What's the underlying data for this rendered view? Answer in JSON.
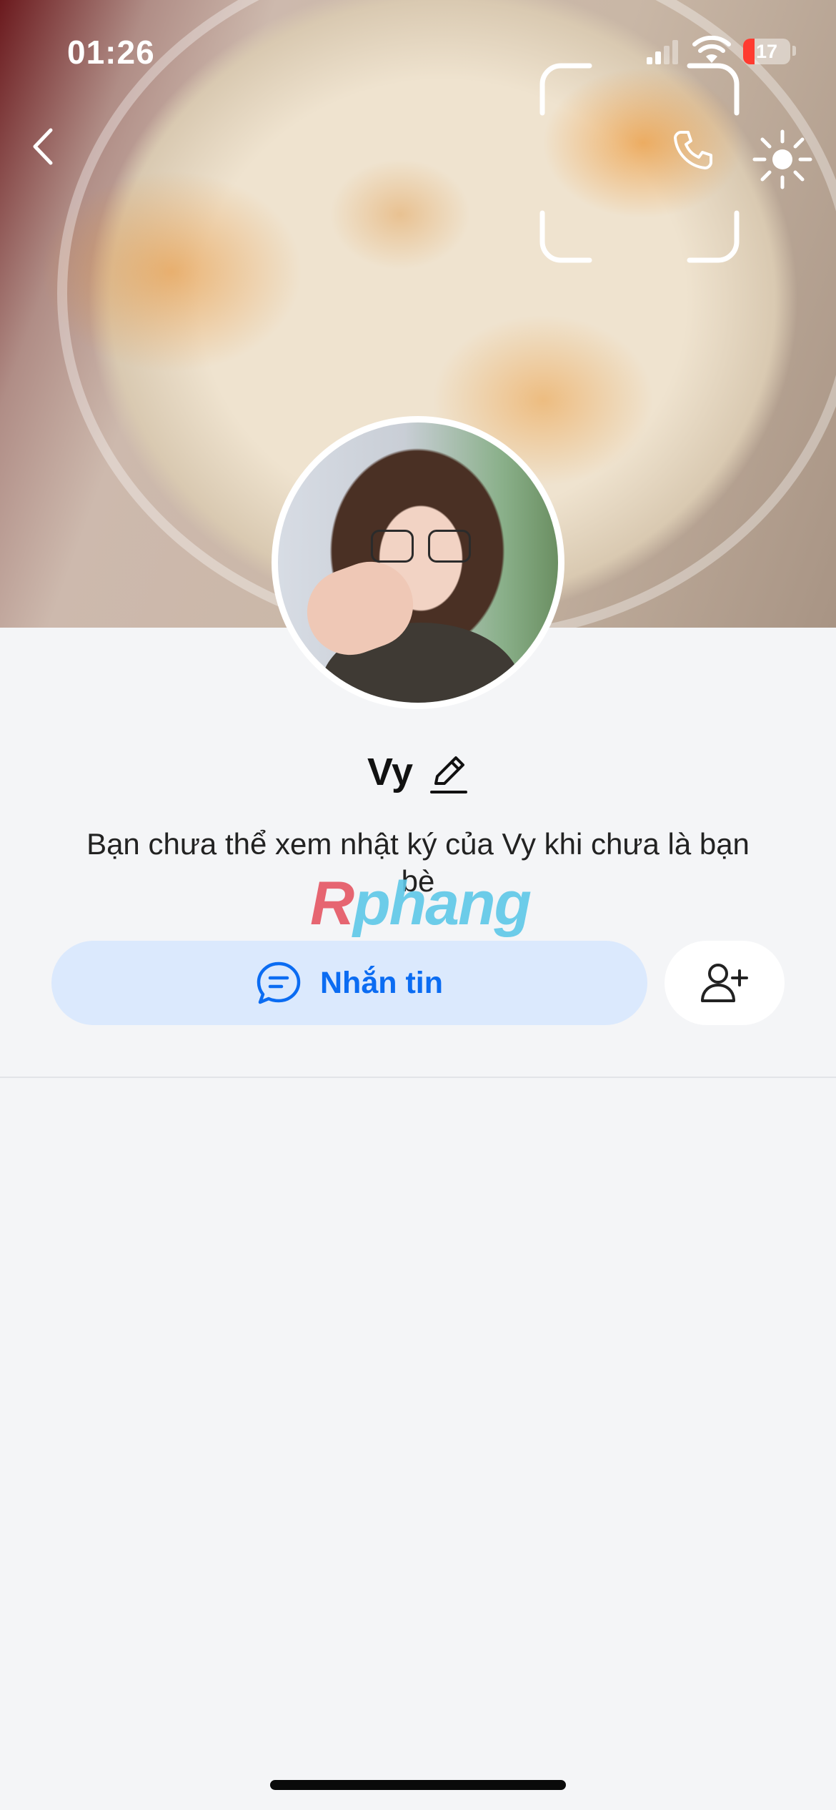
{
  "status_bar": {
    "time": "01:26",
    "battery": "17"
  },
  "profile": {
    "name": "Vy",
    "notice": "Bạn chưa thể xem nhật ký của Vy khi chưa là bạn bè"
  },
  "actions": {
    "message_label": "Nhắn tin"
  },
  "watermark": {
    "text_r": "R",
    "text_rest": "phang"
  },
  "icons": {
    "back": "chevron-left-icon",
    "call": "phone-icon",
    "settings": "settings-sun-icon",
    "scan": "scan-frame-icon",
    "edit": "pencil-icon",
    "message": "chat-bubble-icon",
    "add_friend": "add-user-icon"
  },
  "colors": {
    "accent": "#0b6cf2",
    "message_bg": "#dbe9fd",
    "page_bg": "#f4f5f7"
  }
}
